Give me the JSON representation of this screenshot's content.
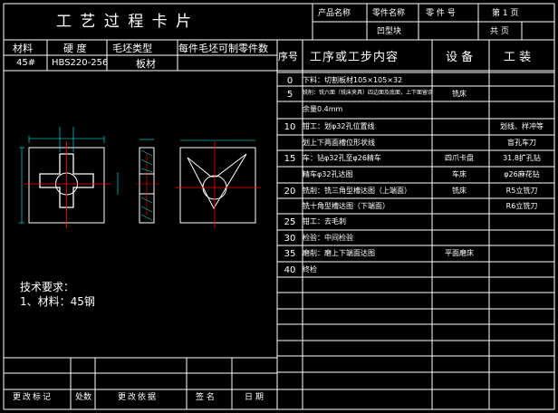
{
  "header": {
    "title": "工 艺 过 程 卡 片",
    "product_name_label": "产品名称",
    "part_name_label": "零件名称",
    "part_number_label": "零 件 号",
    "sheet_label": "第 1 页",
    "part_name_value": "凹型块",
    "total_label": "共 页"
  },
  "material_block": {
    "headers": [
      "材料",
      "硬 度",
      "毛坯类型",
      "每件毛坯可制零件数"
    ],
    "values": [
      "45#",
      "HBS220-256",
      "板材",
      ""
    ]
  },
  "process_table": {
    "headers": {
      "seq": "序号",
      "content": "工序或工步内容",
      "equipment": "设 备",
      "tooling": "工 装"
    },
    "rows": [
      {
        "seq": "0",
        "content": "下料：切割板材105×105×32",
        "equipment": "",
        "tooling": ""
      },
      {
        "seq": "5",
        "content": "铣削：铣六面（铣床夹具）四边面及底面，上下面留余",
        "equipment": "铣床",
        "tooling": ""
      },
      {
        "seq": "",
        "content": "余量0.4mm",
        "equipment": "",
        "tooling": ""
      },
      {
        "seq": "10",
        "content": "钳工：划φ32孔位置线",
        "equipment": "",
        "tooling": "划线、样冲等"
      },
      {
        "seq": "",
        "content": "划上下两面槽位形状线",
        "equipment": "",
        "tooling": "盲孔车刀"
      },
      {
        "seq": "15",
        "content": "车：钻φ32孔至φ26精车",
        "equipment": "四爪卡盘",
        "tooling": "31.8扩孔钻"
      },
      {
        "seq": "",
        "content": "精车φ32孔达图",
        "equipment": "车床",
        "tooling": "φ26麻花钻"
      },
      {
        "seq": "20",
        "content": "铣削：铣三角型槽达图（上端面）",
        "equipment": "铣床",
        "tooling": "R5立铣刀"
      },
      {
        "seq": "",
        "content": "铣十角型槽达图（下端面）",
        "equipment": "",
        "tooling": "R6立铣刀"
      },
      {
        "seq": "25",
        "content": "钳工：去毛刺",
        "equipment": "",
        "tooling": ""
      },
      {
        "seq": "30",
        "content": "检验：中间检验",
        "equipment": "",
        "tooling": ""
      },
      {
        "seq": "35",
        "content": "磨削：磨上下端面达图",
        "equipment": "平面磨床",
        "tooling": ""
      },
      {
        "seq": "40",
        "content": "终检",
        "equipment": "",
        "tooling": ""
      },
      {
        "seq": "",
        "content": "",
        "equipment": "",
        "tooling": ""
      },
      {
        "seq": "",
        "content": "",
        "equipment": "",
        "tooling": ""
      },
      {
        "seq": "",
        "content": "",
        "equipment": "",
        "tooling": ""
      },
      {
        "seq": "",
        "content": "",
        "equipment": "",
        "tooling": ""
      },
      {
        "seq": "",
        "content": "",
        "equipment": "",
        "tooling": ""
      },
      {
        "seq": "",
        "content": "",
        "equipment": "",
        "tooling": ""
      }
    ]
  },
  "notes": {
    "heading": "技术要求：",
    "line1": "1、材料：45钢"
  },
  "footer": {
    "labels": [
      "更改标记",
      "处数",
      "更改依据",
      "签 名",
      "日 期"
    ]
  },
  "colors": {
    "background": "#000000",
    "line": "#ffffff",
    "drawing_line": "#ffffff",
    "center_line": "#ff0000",
    "dimension": "#00ffff",
    "text": "#ffffff"
  }
}
